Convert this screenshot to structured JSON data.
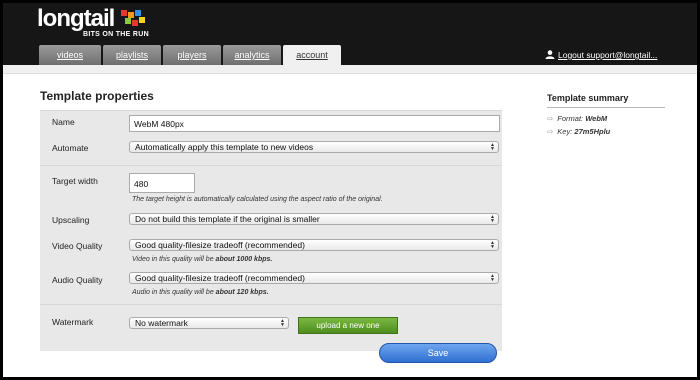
{
  "brand": {
    "name": "longtail",
    "tagline": "BITS ON THE RUN"
  },
  "tabs": [
    {
      "label": "videos",
      "active": false
    },
    {
      "label": "playlists",
      "active": false
    },
    {
      "label": "players",
      "active": false
    },
    {
      "label": "analytics",
      "active": false
    },
    {
      "label": "account",
      "active": true
    }
  ],
  "logout": {
    "label": "Logout support@longtail..."
  },
  "page": {
    "title": "Template properties"
  },
  "form": {
    "name": {
      "label": "Name",
      "value": "WebM 480px"
    },
    "automate": {
      "label": "Automate",
      "value": "Automatically apply this template to new videos"
    },
    "target_width": {
      "label": "Target width",
      "value": "480",
      "hint": "The target height is automatically calculated using the aspect ratio of the original."
    },
    "upscaling": {
      "label": "Upscaling",
      "value": "Do not build this template if the original is smaller"
    },
    "video_quality": {
      "label": "Video Quality",
      "value": "Good quality-filesize tradeoff (recommended)",
      "hint_prefix": "Video in this quality will be",
      "hint_value": "about 1000 kbps."
    },
    "audio_quality": {
      "label": "Audio Quality",
      "value": "Good quality-filesize tradeoff (recommended)",
      "hint_prefix": "Audio in this quality will be",
      "hint_value": "about 120 kbps."
    },
    "watermark": {
      "label": "Watermark",
      "value": "No watermark",
      "upload_label": "upload a new one"
    },
    "save_label": "Save"
  },
  "summary": {
    "title": "Template summary",
    "format_label": "Format:",
    "format_value": "WebM",
    "key_label": "Key:",
    "key_value": "27m5Hplu"
  },
  "colors": {
    "topbar": "#161616",
    "panel": "#e8e8e8",
    "save": "#2f6fd0",
    "upload": "#5c9b2a"
  }
}
